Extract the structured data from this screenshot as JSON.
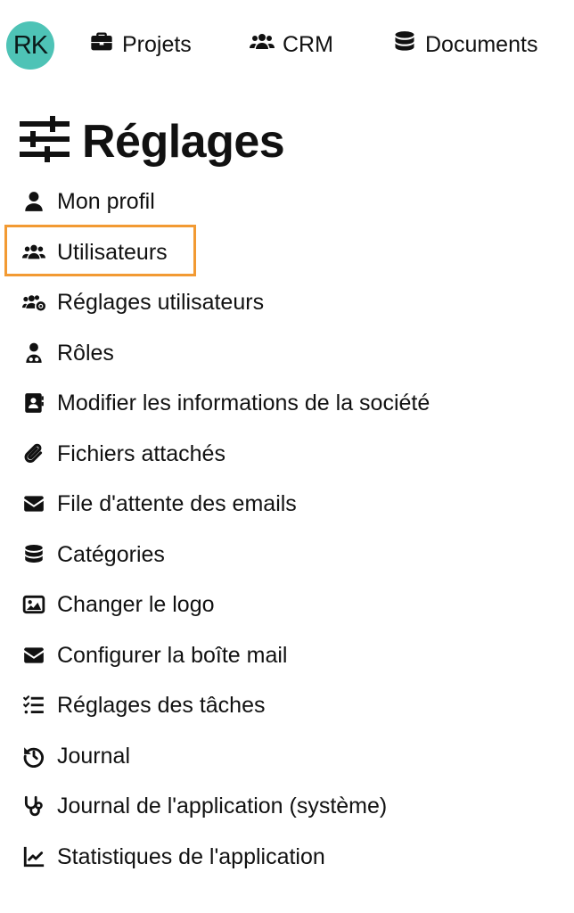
{
  "nav": {
    "avatar_initials": "RK",
    "items": [
      {
        "label": "Projets",
        "icon": "briefcase-icon"
      },
      {
        "label": "CRM",
        "icon": "users-icon"
      },
      {
        "label": "Documents",
        "icon": "database-icon"
      }
    ]
  },
  "page": {
    "title": "Réglages",
    "title_icon": "sliders-icon"
  },
  "menu": {
    "highlight_color": "#f29a33",
    "items": [
      {
        "label": "Mon profil",
        "icon": "user-icon"
      },
      {
        "label": "Utilisateurs",
        "icon": "users-icon"
      },
      {
        "label": "Réglages utilisateurs",
        "icon": "users-cog-icon"
      },
      {
        "label": "Rôles",
        "icon": "user-doctor-icon"
      },
      {
        "label": "Modifier les informations de la société",
        "icon": "address-card-icon"
      },
      {
        "label": "Fichiers attachés",
        "icon": "paperclip-icon"
      },
      {
        "label": "File d'attente des emails",
        "icon": "envelope-icon"
      },
      {
        "label": "Catégories",
        "icon": "database-icon"
      },
      {
        "label": "Changer le logo",
        "icon": "image-icon"
      },
      {
        "label": "Configurer la boîte mail",
        "icon": "envelope-icon"
      },
      {
        "label": "Réglages des tâches",
        "icon": "list-check-icon"
      },
      {
        "label": "Journal",
        "icon": "history-icon"
      },
      {
        "label": "Journal de l'application (système)",
        "icon": "stethoscope-icon"
      },
      {
        "label": "Statistiques de l'application",
        "icon": "chart-line-icon"
      }
    ]
  }
}
